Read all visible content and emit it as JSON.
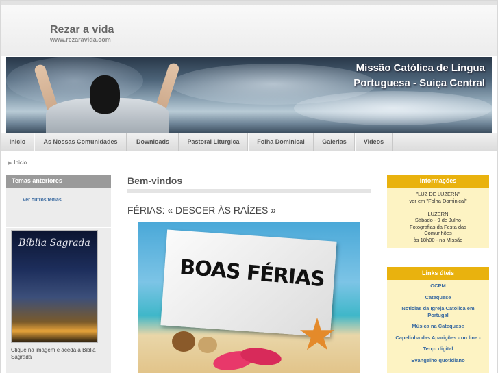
{
  "site": {
    "title": "Rezar a vida",
    "url": "www.rezaravida.com"
  },
  "banner": {
    "line1": "Missão Católica de Língua",
    "line2": "Portuguesa - Suiça Central"
  },
  "nav": {
    "items": [
      {
        "label": "Inicio"
      },
      {
        "label": "As Nossas Comunidades"
      },
      {
        "label": "Downloads"
      },
      {
        "label": "Pastoral Liturgica"
      },
      {
        "label": "Folha Dominical"
      },
      {
        "label": "Galerias"
      },
      {
        "label": "Videos"
      }
    ]
  },
  "breadcrumb": {
    "label": "Inicio"
  },
  "left": {
    "heading": "Temas anteriores",
    "link": "Ver outros temas",
    "image_title": "Bíblia Sagrada",
    "caption": "Clique na imagem e aceda à Biblia Sagrada"
  },
  "main": {
    "title": "Bem-vindos",
    "post_title": "FÉRIAS: « DESCER ÀS RAÍZES »",
    "image_text": "BOAS FÉRIAS"
  },
  "info": {
    "heading": "Informações",
    "lines": [
      "\"LUZ DE LUZERN\"",
      "ver em \"Folha Dominical\"",
      "",
      "LUZERN",
      "Sábado - 9 de Julho",
      "Fotografias da Festa das",
      "Comunhões",
      "às 18h00 - na Missão"
    ]
  },
  "links": {
    "heading": "Links úteis",
    "items": [
      "OCPM",
      "Catequese",
      "Noticias da Igreja Católica em Portugal",
      "Música na Catequese",
      "Capelinha das Aparições - on line -",
      "Terço digital",
      "Evangelho quotidiano"
    ]
  }
}
